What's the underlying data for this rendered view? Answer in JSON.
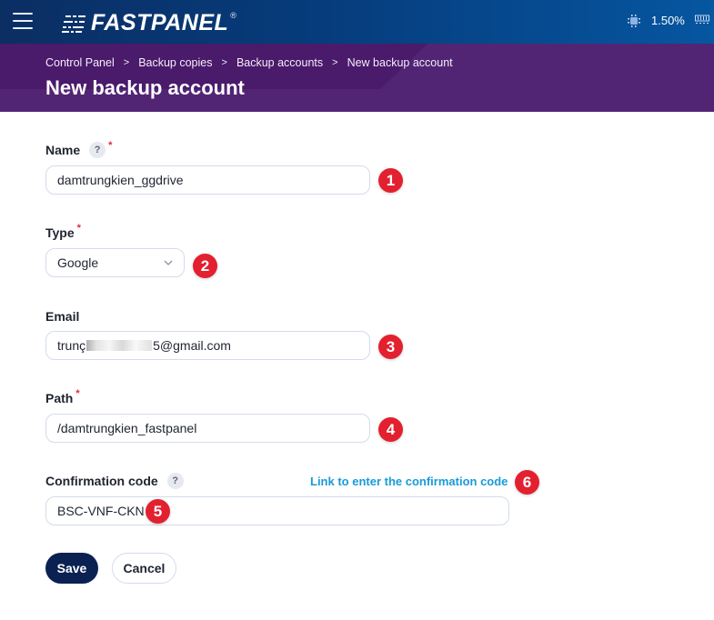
{
  "topbar": {
    "logo_text": "FASTPANEL",
    "logo_reg": "®",
    "menu_icon": "hamburger-menu-icon",
    "cpu_icon": "cpu-chip-icon",
    "cpu_usage": "1.50%",
    "ram_icon": "memory-module-icon"
  },
  "header": {
    "breadcrumb": [
      "Control Panel",
      "Backup copies",
      "Backup accounts",
      "New backup account"
    ],
    "separator": ">",
    "title": "New backup account"
  },
  "form": {
    "name": {
      "label": "Name",
      "required": "*",
      "help": "?",
      "value": "damtrungkien_ggdrive"
    },
    "type": {
      "label": "Type",
      "required": "*",
      "selected": "Google"
    },
    "email": {
      "label": "Email",
      "value_prefix": "trunç",
      "value_suffix": "5@gmail.com"
    },
    "path": {
      "label": "Path",
      "required": "*",
      "value": "/damtrungkien_fastpanel"
    },
    "confirmation": {
      "label": "Confirmation code",
      "help": "?",
      "link_text": "Link to enter the confirmation code",
      "value": "BSC-VNF-CKN"
    },
    "buttons": {
      "save": "Save",
      "cancel": "Cancel"
    }
  },
  "annotations": [
    "1",
    "2",
    "3",
    "4",
    "5",
    "6"
  ],
  "colors": {
    "topbar_start": "#0b2e63",
    "topbar_end": "#0656a0",
    "header_bg": "#522574",
    "badge": "#e3202f",
    "link": "#1a9ad8",
    "save_button": "#0a2152",
    "required": "#e0283c"
  }
}
